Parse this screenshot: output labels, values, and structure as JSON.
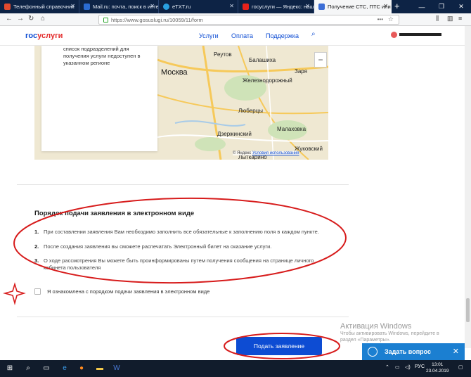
{
  "browser": {
    "tabs": [
      {
        "label": "Телефонный справочник",
        "icon_color": "#e24a2e",
        "active": false
      },
      {
        "label": "Mail.ru: почта, поиск в инте",
        "icon_color": "#2a6bd1",
        "active": false
      },
      {
        "label": "eTXT.ru",
        "icon_color": "#29a0e0",
        "active": false
      },
      {
        "label": "госуслуги — Яндекс: нашлс",
        "icon_color": "#e8221b",
        "active": false
      },
      {
        "label": "Получение СТС, ПТС или д",
        "icon_color": "#3c6ed6",
        "active": true
      }
    ],
    "url": "https://www.gosuslugi.ru/10059/11/form"
  },
  "site": {
    "logo_part1": "гос",
    "logo_part2": "услуги",
    "nav": [
      "Услуги",
      "Оплата",
      "Поддержка"
    ]
  },
  "map": {
    "card_text": [
      "список подразделений для",
      "получения услуги недоступен в",
      "указанном регионе"
    ],
    "cities": [
      "Москва",
      "Балашиха",
      "Железнодорожный",
      "Люберцы",
      "Дзержинский",
      "Малаховка",
      "Жуковский",
      "Лыткарино",
      "Заря",
      "Реутов"
    ],
    "copyright": "© Яндекс",
    "terms": "Условия использования",
    "zoom_out": "−"
  },
  "procedure": {
    "title": "Порядок подачи заявления в электронном виде",
    "steps": [
      {
        "num": "1.",
        "text": "При составлении заявления Вам необходимо заполнить все обязательные к заполнению поля в каждом пункте."
      },
      {
        "num": "2.",
        "text": "После создания заявления вы сможете распечатать Электронный билет на оказание услуги."
      },
      {
        "num": "3.",
        "text": "О ходе рассмотрения Вы можете быть проинформированы путем получения сообщения на странице личного кабинета пользователя"
      }
    ]
  },
  "agreement": {
    "label": "Я ознакомлена с порядком подачи заявления в электронном виде",
    "checked": false
  },
  "submit_label": "Подать заявление",
  "watermark": {
    "line1": "Активация Windows",
    "line2": "Чтобы активировать Windows, перейдите в",
    "line3": "раздел «Параметры»."
  },
  "chat": {
    "label": "Задать вопрос"
  },
  "taskbar": {
    "lang": "РУС",
    "time": "13:01",
    "date": "23.04.2019"
  },
  "colors": {
    "brand_blue": "#0d4cd3",
    "brand_red": "#e32b2b",
    "annotation_red": "#d71c1c",
    "chat_blue": "#1b7fd1"
  }
}
